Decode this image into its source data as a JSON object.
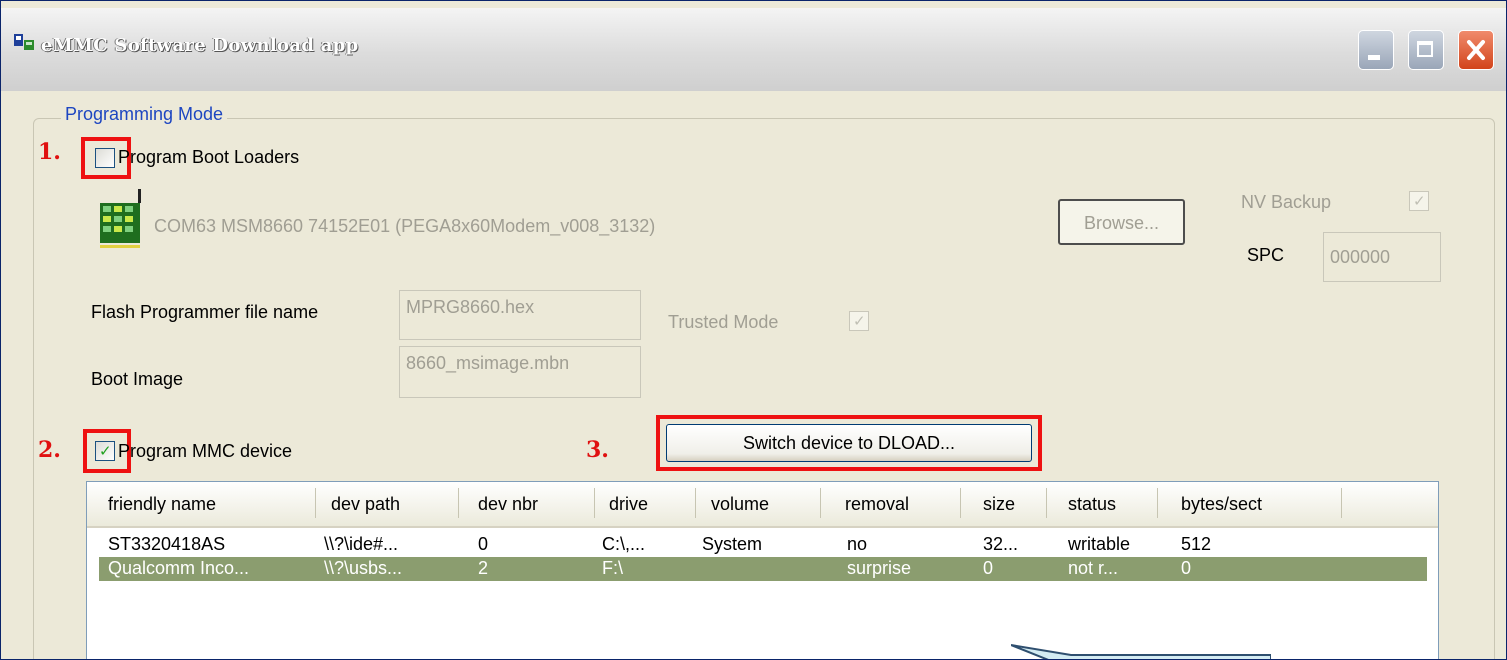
{
  "window": {
    "title": "eMMC Software Download app",
    "controls": [
      "minimize-icon",
      "maximize-icon",
      "close-icon"
    ]
  },
  "programming_mode": {
    "group_label": "Programming Mode",
    "program_boot_loaders": {
      "label": "Program Boot Loaders",
      "checked": false,
      "step_marker": "1."
    },
    "device": {
      "icon": "phone-chip-icon",
      "text": "COM63  MSM8660  74152E01  (PEGA8x60Modem_v008_3132)"
    },
    "browse_label": "Browse...",
    "nv_backup": {
      "label": "NV Backup",
      "checked": true
    },
    "spc": {
      "label": "SPC",
      "value": "000000"
    },
    "flash_programmer": {
      "label": "Flash Programmer file name",
      "value": "MPRG8660.hex"
    },
    "trusted_mode": {
      "label": "Trusted Mode",
      "checked": true
    },
    "boot_image": {
      "label": "Boot Image",
      "value": "8660_msimage.mbn"
    },
    "program_mmc": {
      "label": "Program MMC device",
      "checked": true,
      "step_marker": "2."
    },
    "switch_dload": {
      "label": "Switch device to DLOAD...",
      "step_marker": "3."
    }
  },
  "device_list": {
    "columns": [
      "friendly name",
      "dev path",
      "dev nbr",
      "drive",
      "volume",
      "removal",
      "size",
      "status",
      "bytes/sect"
    ],
    "rows": [
      [
        "ST3320418AS",
        "\\\\?\\ide#...",
        "0",
        "C:\\,...",
        "System",
        "no",
        "32...",
        "writable",
        "512"
      ],
      [
        "Qualcomm  Inco...",
        "\\\\?\\usbs...",
        "2",
        "F:\\",
        "",
        "surprise",
        "0",
        "not r...",
        "0"
      ]
    ],
    "selected_row": 1
  },
  "colors": {
    "annotation_red": "#ee1111",
    "selection": "#8b9d6f",
    "group_label": "#1d46c1"
  }
}
